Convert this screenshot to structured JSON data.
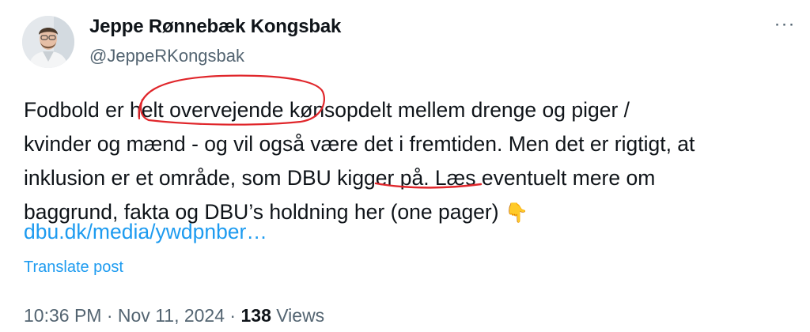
{
  "author": {
    "display_name": "Jeppe Rønnebæk Kongsbak",
    "handle": "@JeppeRKongsbak"
  },
  "more_label": "···",
  "post": {
    "lines": [
      "Fodbold er helt overvejende kønsopdelt mellem drenge og piger /",
      "kvinder og mænd - og vil også være det i fremtiden. Men det er rigtigt, at",
      "inklusion er et område, som DBU kigger på. Læs eventuelt mere om",
      "baggrund, fakta og DBU’s holdning her (one pager)"
    ],
    "emoji": "👇",
    "link": "dbu.dk/media/ywdpnber…"
  },
  "translate_label": "Translate post",
  "meta": {
    "time": "10:36 PM",
    "separator": "·",
    "date": "Nov 11, 2024",
    "views_count": "138",
    "views_label": "Views"
  },
  "annotation_color": "#e0262b",
  "link_color": "#1d9bf0"
}
